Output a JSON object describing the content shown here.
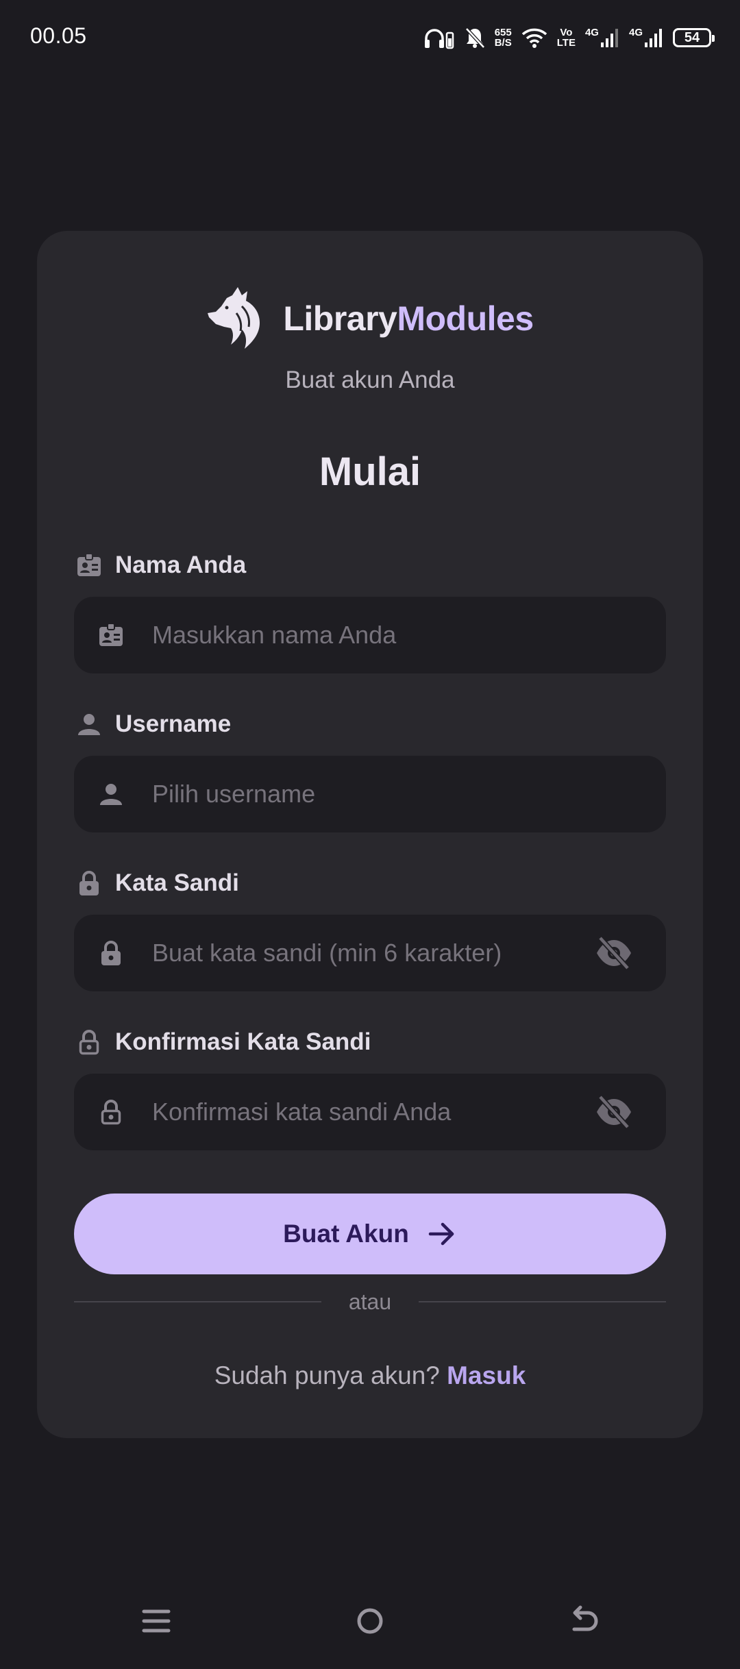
{
  "status_bar": {
    "time": "00.05",
    "net_speed_top": "655",
    "net_speed_bottom": "B/S",
    "volte_top": "Vo",
    "volte_bottom": "LTE",
    "sim1_label": "4G",
    "sim2_label": "4G",
    "battery": "54",
    "icons": [
      "headphones-icon",
      "bell-off-icon",
      "wifi-icon",
      "signal-icon",
      "battery-icon"
    ]
  },
  "brand": {
    "logo_icon": "wolf-logo-icon",
    "name_part1": "Library",
    "name_part2": "Modules"
  },
  "subtitle": "Buat akun Anda",
  "heading": "Mulai",
  "form": {
    "name": {
      "label": "Nama Anda",
      "placeholder": "Masukkan nama Anda",
      "value": "",
      "icon": "id-badge-icon"
    },
    "username": {
      "label": "Username",
      "placeholder": "Pilih username",
      "value": "",
      "icon": "person-icon"
    },
    "password": {
      "label": "Kata Sandi",
      "placeholder": "Buat kata sandi (min 6 karakter)",
      "value": "",
      "icon": "lock-icon",
      "toggle_icon": "eye-off-icon"
    },
    "confirm_password": {
      "label": "Konfirmasi Kata Sandi",
      "placeholder": "Konfirmasi kata sandi Anda",
      "value": "",
      "icon": "lock-outline-icon",
      "toggle_icon": "eye-off-icon"
    }
  },
  "submit_label": "Buat Akun",
  "divider_text": "atau",
  "signin": {
    "prompt": "Sudah punya akun?",
    "link": "Masuk"
  },
  "nav": {
    "items": [
      "menu-icon",
      "home-icon",
      "back-icon"
    ]
  },
  "colors": {
    "background": "#1c1b20",
    "card": "#29282d",
    "input": "#1e1d22",
    "accent": "#cfbdfa",
    "accent_text": "#2c1a5a",
    "link": "#b9a6ee"
  }
}
